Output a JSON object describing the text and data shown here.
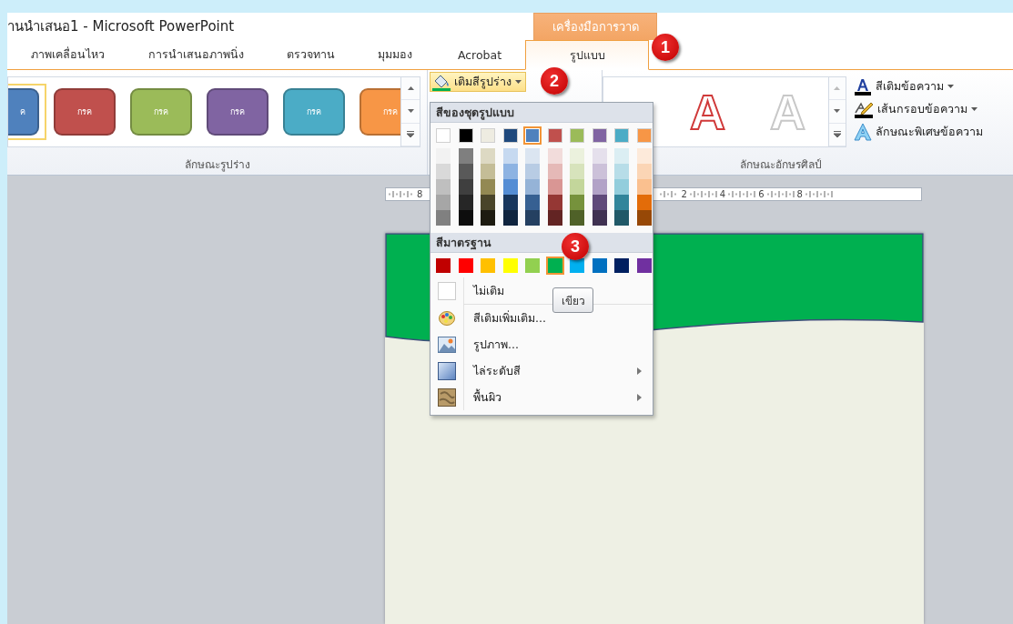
{
  "window": {
    "title": "านนำเสนอ1  -  Microsoft PowerPoint",
    "context_header": "เครื่องมือการวาด"
  },
  "tabs": [
    {
      "label": "ภาพเคลื่อนไหว",
      "selected": false
    },
    {
      "label": "การนำเสนอภาพนิ่ง",
      "selected": false
    },
    {
      "label": "ตรวจทาน",
      "selected": false
    },
    {
      "label": "มุมมอง",
      "selected": false
    },
    {
      "label": "Acrobat",
      "selected": false
    },
    {
      "label": "รูปแบบ",
      "selected": true
    }
  ],
  "shape_styles": {
    "label": "ลักษณะรูปร่าง",
    "items": [
      {
        "text": "ค",
        "color": "#4f81bd",
        "selected": true
      },
      {
        "text": "กรค",
        "color": "#c0504d",
        "selected": false
      },
      {
        "text": "กรค",
        "color": "#9bbb59",
        "selected": false
      },
      {
        "text": "กรค",
        "color": "#8064a2",
        "selected": false
      },
      {
        "text": "กรค",
        "color": "#4bacc6",
        "selected": false
      },
      {
        "text": "กรค",
        "color": "#f79646",
        "selected": false
      }
    ]
  },
  "fill_button": {
    "label": "เติมสีรูปร่าง"
  },
  "wordart": {
    "label": "ลักษณะอักษรศิลป์",
    "items": [
      {
        "glyph": "A",
        "kind": "red-outline"
      },
      {
        "glyph": "A",
        "kind": "gray-outline"
      }
    ],
    "buttons": [
      {
        "label": "สีเติมข้อความ",
        "kind": "text-fill",
        "dropdown": true
      },
      {
        "label": "เส้นกรอบข้อความ",
        "kind": "text-outline",
        "dropdown": true
      },
      {
        "label": "ลักษณะพิเศษข้อความ",
        "kind": "text-effects",
        "dropdown": false
      }
    ]
  },
  "ruler": {
    "left_labels": [
      "8"
    ],
    "right_labels": [
      "2",
      "4",
      "6",
      "8"
    ]
  },
  "fill_menu": {
    "theme_heading": "สีของชุดรูปแบบ",
    "theme_colors": [
      {
        "color": "#ffffff",
        "selected": false,
        "shades": [
          {
            "color": "#f2f2f2"
          },
          {
            "color": "#d9d9d9"
          },
          {
            "color": "#bfbfbf"
          },
          {
            "color": "#a6a6a6"
          },
          {
            "color": "#808080"
          }
        ]
      },
      {
        "color": "#000000",
        "selected": false,
        "shades": [
          {
            "color": "#7f7f7f"
          },
          {
            "color": "#595959"
          },
          {
            "color": "#3f3f3f"
          },
          {
            "color": "#262626"
          },
          {
            "color": "#0d0d0d"
          }
        ]
      },
      {
        "color": "#eeece1",
        "selected": false,
        "shades": [
          {
            "color": "#ddd9c3"
          },
          {
            "color": "#c4bd97"
          },
          {
            "color": "#938953"
          },
          {
            "color": "#494429"
          },
          {
            "color": "#1d1b10"
          }
        ]
      },
      {
        "color": "#1f497d",
        "selected": false,
        "shades": [
          {
            "color": "#c6d9f0"
          },
          {
            "color": "#8db3e2"
          },
          {
            "color": "#548dd4"
          },
          {
            "color": "#17365d"
          },
          {
            "color": "#0f243e"
          }
        ]
      },
      {
        "color": "#4f81bd",
        "selected": true,
        "shades": [
          {
            "color": "#dbe5f1"
          },
          {
            "color": "#b8cce4"
          },
          {
            "color": "#95b3d7"
          },
          {
            "color": "#366092"
          },
          {
            "color": "#244061"
          }
        ]
      },
      {
        "color": "#c0504d",
        "selected": false,
        "shades": [
          {
            "color": "#f2dcdb"
          },
          {
            "color": "#e5b9b7"
          },
          {
            "color": "#d99694"
          },
          {
            "color": "#953734"
          },
          {
            "color": "#632423"
          }
        ]
      },
      {
        "color": "#9bbb59",
        "selected": false,
        "shades": [
          {
            "color": "#ebf1dd"
          },
          {
            "color": "#d7e3bc"
          },
          {
            "color": "#c3d69b"
          },
          {
            "color": "#76923c"
          },
          {
            "color": "#4f6128"
          }
        ]
      },
      {
        "color": "#8064a2",
        "selected": false,
        "shades": [
          {
            "color": "#e5e0ec"
          },
          {
            "color": "#ccc1d9"
          },
          {
            "color": "#b2a2c7"
          },
          {
            "color": "#5f497a"
          },
          {
            "color": "#3f3151"
          }
        ]
      },
      {
        "color": "#4bacc6",
        "selected": false,
        "shades": [
          {
            "color": "#dbeef3"
          },
          {
            "color": "#b7dde8"
          },
          {
            "color": "#92cddc"
          },
          {
            "color": "#31859b"
          },
          {
            "color": "#205867"
          }
        ]
      },
      {
        "color": "#f79646",
        "selected": false,
        "shades": [
          {
            "color": "#fdeada"
          },
          {
            "color": "#fbd5b5"
          },
          {
            "color": "#fac08f"
          },
          {
            "color": "#e36c09"
          },
          {
            "color": "#974806"
          }
        ]
      }
    ],
    "standard_heading": "สีมาตรฐาน",
    "standard_colors": [
      {
        "color": "#c00000",
        "selected": false
      },
      {
        "color": "#ff0000",
        "selected": false
      },
      {
        "color": "#ffc000",
        "selected": false
      },
      {
        "color": "#ffff00",
        "selected": false
      },
      {
        "color": "#92d050",
        "selected": false
      },
      {
        "color": "#00b050",
        "selected": true
      },
      {
        "color": "#00b0f0",
        "selected": false
      },
      {
        "color": "#0070c0",
        "selected": false
      },
      {
        "color": "#002060",
        "selected": false
      },
      {
        "color": "#7030a0",
        "selected": false
      }
    ],
    "items": [
      {
        "label": "ไม่เติม",
        "kind": "no-fill",
        "submenu": false
      },
      {
        "label": "สีเติมเพิ่มเติม...",
        "kind": "palette",
        "submenu": false
      },
      {
        "label": "รูปภาพ...",
        "kind": "picture",
        "submenu": false
      },
      {
        "label": "ไล่ระดับสี",
        "kind": "gradient",
        "submenu": true
      },
      {
        "label": "พื้นผิว",
        "kind": "texture",
        "submenu": true
      }
    ],
    "tooltip": "เขียว"
  },
  "badges": [
    {
      "text": "1"
    },
    {
      "text": "2"
    },
    {
      "text": "3"
    }
  ]
}
